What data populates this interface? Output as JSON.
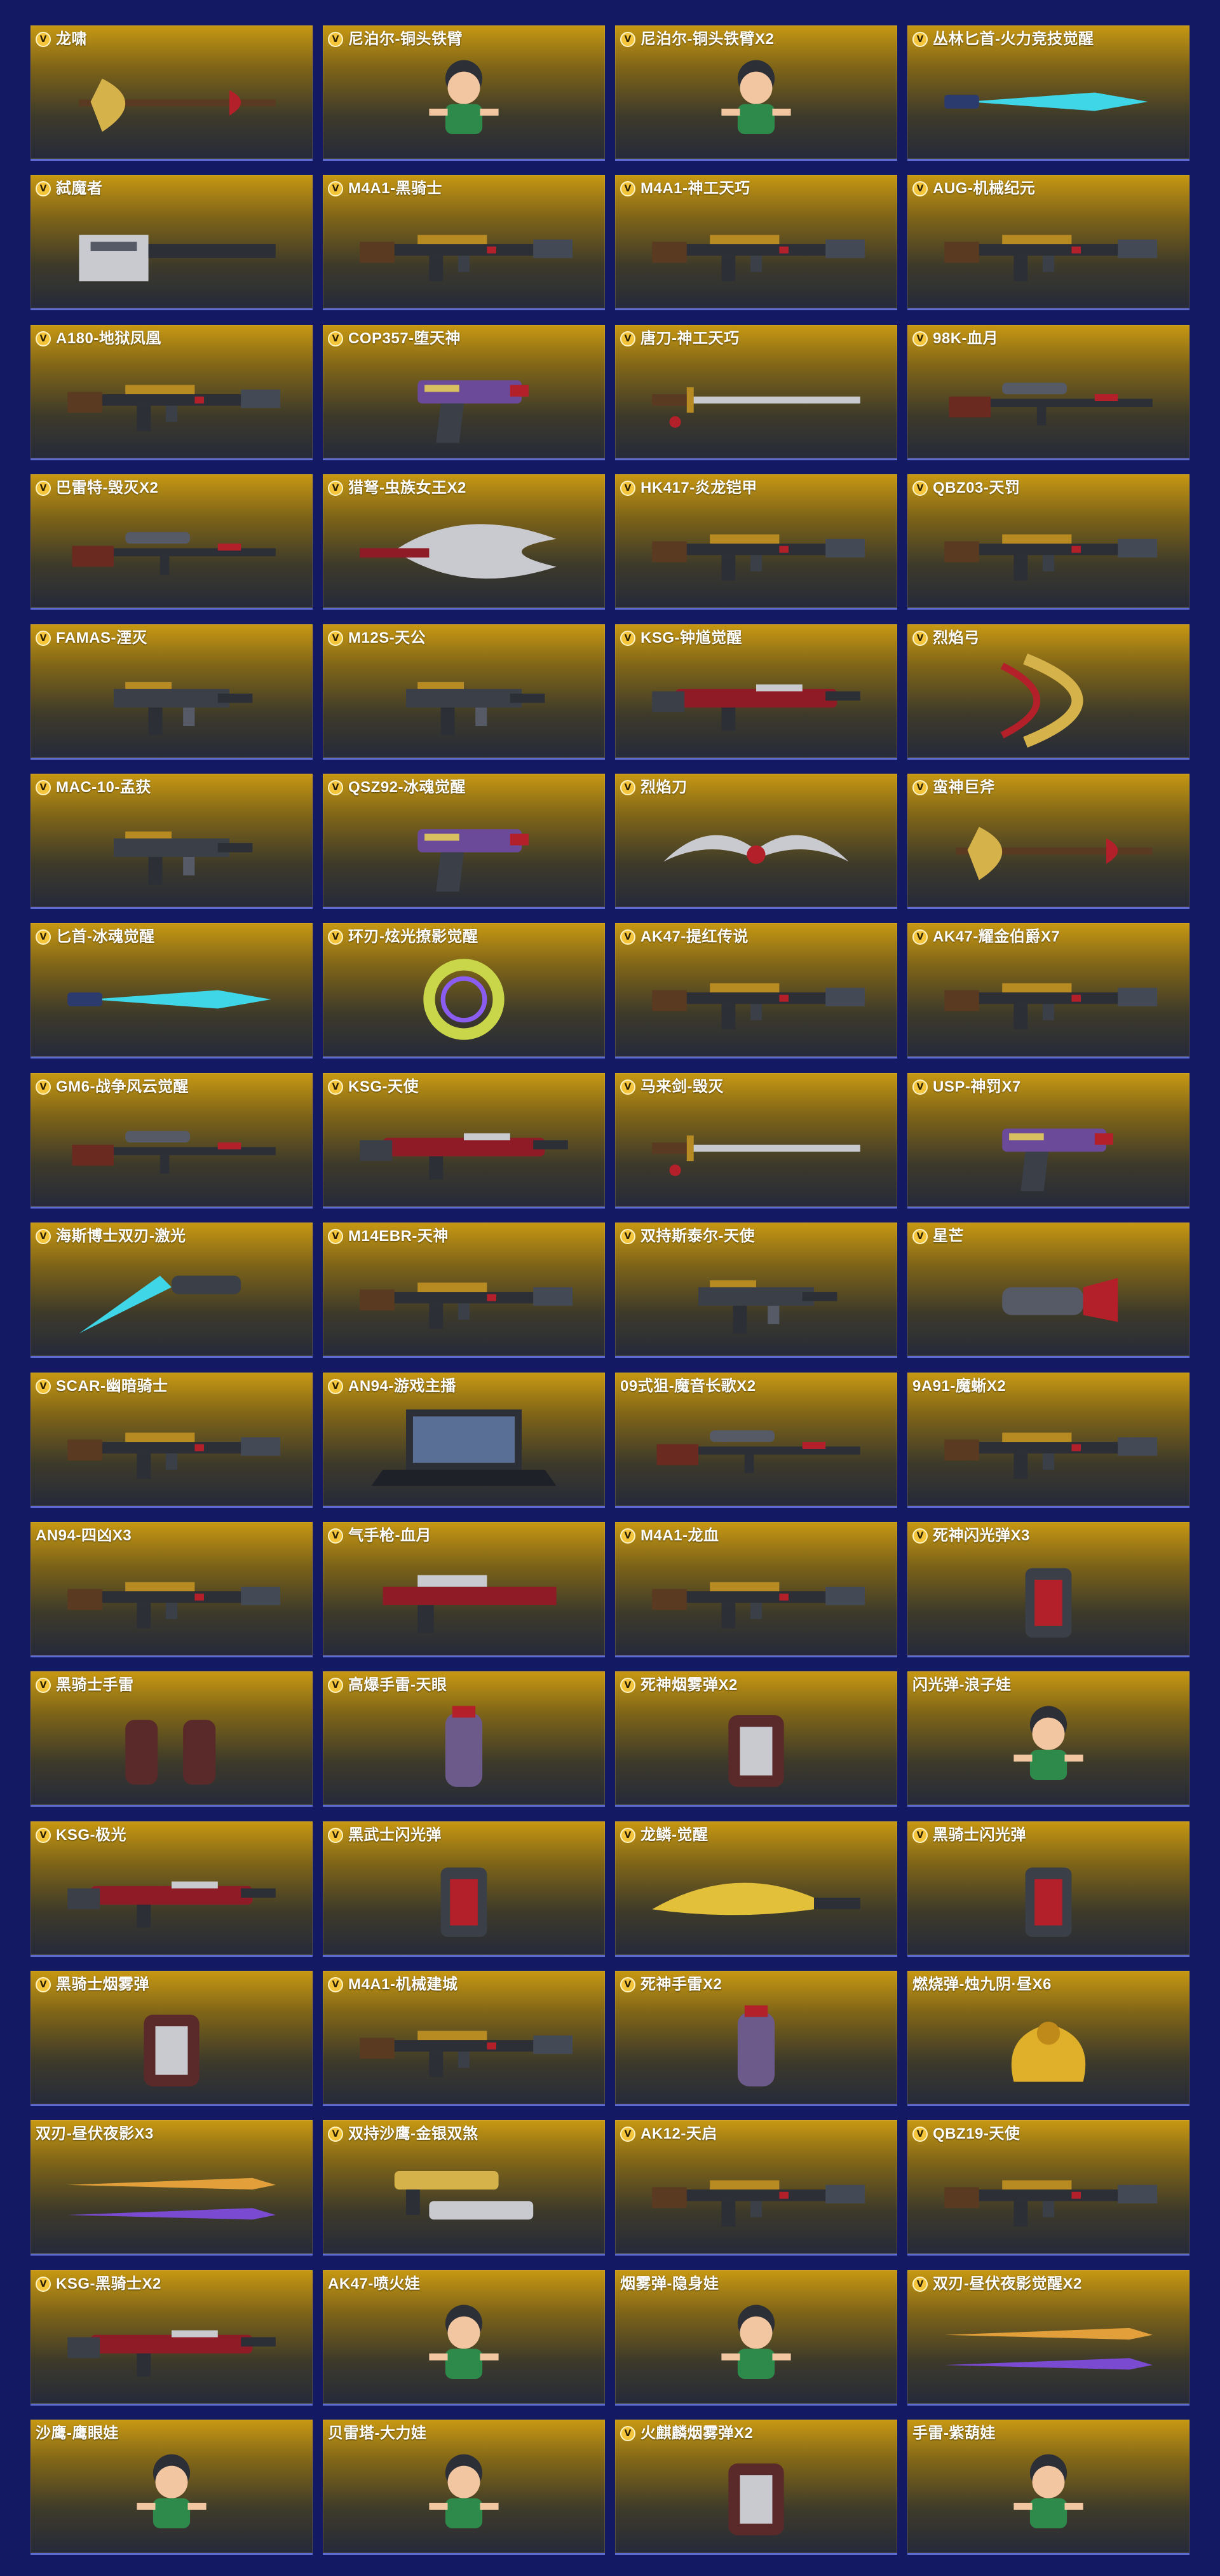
{
  "items": [
    {
      "name": "龙啸",
      "vip": true,
      "badge": "V",
      "icon": "axe-icon"
    },
    {
      "name": "尼泊尔-铜头铁臂",
      "vip": true,
      "badge": "V",
      "icon": "calabash-boy-icon"
    },
    {
      "name": "尼泊尔-铜头铁臂X2",
      "vip": true,
      "badge": "V",
      "icon": "calabash-boy-icon"
    },
    {
      "name": "丛林匕首-火力竞技觉醒",
      "vip": true,
      "badge": "V",
      "icon": "knife-icon"
    },
    {
      "name": "弑魔者",
      "vip": true,
      "badge": "V",
      "icon": "heavy-gun-icon"
    },
    {
      "name": "M4A1-黑骑士",
      "vip": true,
      "badge": "V",
      "icon": "rifle-icon"
    },
    {
      "name": "M4A1-神工天巧",
      "vip": true,
      "badge": "V",
      "icon": "rifle-icon"
    },
    {
      "name": "AUG-机械纪元",
      "vip": true,
      "badge": "V",
      "icon": "rifle-icon"
    },
    {
      "name": "A180-地狱凤凰",
      "vip": true,
      "badge": "V",
      "icon": "rifle-icon"
    },
    {
      "name": "COP357-堕天神",
      "vip": true,
      "badge": "V",
      "icon": "pistol-icon"
    },
    {
      "name": "唐刀-神工天巧",
      "vip": true,
      "badge": "V",
      "icon": "sword-icon"
    },
    {
      "name": "98K-血月",
      "vip": true,
      "badge": "V",
      "icon": "sniper-icon"
    },
    {
      "name": "巴雷特-毁灭X2",
      "vip": true,
      "badge": "V",
      "icon": "sniper-icon"
    },
    {
      "name": "猎弩-虫族女王X2",
      "vip": true,
      "badge": "V",
      "icon": "crossbow-icon"
    },
    {
      "name": "HK417-炎龙铠甲",
      "vip": true,
      "badge": "V",
      "icon": "rifle-icon"
    },
    {
      "name": "QBZ03-天罚",
      "vip": true,
      "badge": "V",
      "icon": "rifle-icon"
    },
    {
      "name": "FAMAS-湮灭",
      "vip": true,
      "badge": "V",
      "icon": "smg-icon"
    },
    {
      "name": "M12S-天公",
      "vip": true,
      "badge": "V",
      "icon": "smg-icon"
    },
    {
      "name": "KSG-钟馗觉醒",
      "vip": true,
      "badge": "V",
      "icon": "shotgun-icon"
    },
    {
      "name": "烈焰弓",
      "vip": true,
      "badge": "V",
      "icon": "bow-icon"
    },
    {
      "name": "MAC-10-孟获",
      "vip": true,
      "badge": "V",
      "icon": "smg-icon"
    },
    {
      "name": "QSZ92-冰魂觉醒",
      "vip": true,
      "badge": "V",
      "icon": "pistol-icon"
    },
    {
      "name": "烈焰刀",
      "vip": true,
      "badge": "V",
      "icon": "blade-icon"
    },
    {
      "name": "蛮神巨斧",
      "vip": true,
      "badge": "V",
      "icon": "axe-icon"
    },
    {
      "name": "匕首-冰魂觉醒",
      "vip": true,
      "badge": "V",
      "icon": "knife-icon"
    },
    {
      "name": "环刃-炫光撩影觉醒",
      "vip": true,
      "badge": "V",
      "icon": "ring-blade-icon"
    },
    {
      "name": "AK47-提红传说",
      "vip": true,
      "badge": "V",
      "icon": "rifle-icon"
    },
    {
      "name": "AK47-耀金伯爵X7",
      "vip": true,
      "badge": "V",
      "icon": "rifle-icon"
    },
    {
      "name": "GM6-战争风云觉醒",
      "vip": true,
      "badge": "V",
      "icon": "sniper-icon"
    },
    {
      "name": "KSG-天使",
      "vip": true,
      "badge": "V",
      "icon": "shotgun-icon"
    },
    {
      "name": "马来剑-毁灭",
      "vip": true,
      "badge": "V",
      "icon": "sword-icon"
    },
    {
      "name": "USP-神罚X7",
      "vip": true,
      "badge": "V",
      "icon": "pistol-icon"
    },
    {
      "name": "海斯博士双刃-激光",
      "vip": true,
      "badge": "V",
      "icon": "laser-blade-icon"
    },
    {
      "name": "M14EBR-天神",
      "vip": true,
      "badge": "V",
      "icon": "rifle-icon"
    },
    {
      "name": "双持斯泰尔-天使",
      "vip": true,
      "badge": "V",
      "icon": "smg-icon"
    },
    {
      "name": "星芒",
      "vip": true,
      "badge": "V",
      "icon": "gauntlet-icon"
    },
    {
      "name": "SCAR-幽暗骑士",
      "vip": true,
      "badge": "V",
      "icon": "rifle-icon"
    },
    {
      "name": "AN94-游戏主播",
      "vip": true,
      "badge": "V",
      "icon": "laptop-icon"
    },
    {
      "name": "09式狙-魔音长歌X2",
      "vip": false,
      "badge": "",
      "icon": "sniper-icon"
    },
    {
      "name": "9A91-魔蜥X2",
      "vip": false,
      "badge": "",
      "icon": "rifle-icon"
    },
    {
      "name": "AN94-四凶X3",
      "vip": false,
      "badge": "",
      "icon": "rifle-icon"
    },
    {
      "name": "气手枪-血月",
      "vip": true,
      "badge": "V",
      "icon": "air-gun-icon"
    },
    {
      "name": "M4A1-龙血",
      "vip": true,
      "badge": "V",
      "icon": "rifle-icon"
    },
    {
      "name": "死神闪光弹X3",
      "vip": true,
      "badge": "V",
      "icon": "flashbang-icon"
    },
    {
      "name": "黑骑士手雷",
      "vip": true,
      "badge": "V",
      "icon": "grenade-pair-icon"
    },
    {
      "name": "高爆手雷-天眼",
      "vip": true,
      "badge": "V",
      "icon": "grenade-icon"
    },
    {
      "name": "死神烟雾弹X2",
      "vip": true,
      "badge": "V",
      "icon": "smoke-grenade-icon"
    },
    {
      "name": "闪光弹-浪子娃",
      "vip": false,
      "badge": "",
      "icon": "calabash-boy-icon"
    },
    {
      "name": "KSG-极光",
      "vip": true,
      "badge": "V",
      "icon": "shotgun-icon"
    },
    {
      "name": "黑武士闪光弹",
      "vip": true,
      "badge": "V",
      "icon": "flashbang-icon"
    },
    {
      "name": "龙鳞-觉醒",
      "vip": true,
      "badge": "V",
      "icon": "machete-icon"
    },
    {
      "name": "黑骑士闪光弹",
      "vip": true,
      "badge": "V",
      "icon": "flashbang-icon"
    },
    {
      "name": "黑骑士烟雾弹",
      "vip": true,
      "badge": "V",
      "icon": "smoke-grenade-icon"
    },
    {
      "name": "M4A1-机械建城",
      "vip": true,
      "badge": "V",
      "icon": "rifle-icon"
    },
    {
      "name": "死神手雷X2",
      "vip": true,
      "badge": "V",
      "icon": "grenade-icon"
    },
    {
      "name": "燃烧弹-烛九阴·昼X6",
      "vip": false,
      "badge": "",
      "icon": "dragon-icon"
    },
    {
      "name": "双刃-昼伏夜影X3",
      "vip": false,
      "badge": "",
      "icon": "dual-blade-icon"
    },
    {
      "name": "双持沙鹰-金银双煞",
      "vip": true,
      "badge": "V",
      "icon": "dual-pistol-icon"
    },
    {
      "name": "AK12-天启",
      "vip": true,
      "badge": "V",
      "icon": "rifle-icon"
    },
    {
      "name": "QBZ19-天使",
      "vip": true,
      "badge": "V",
      "icon": "rifle-icon"
    },
    {
      "name": "KSG-黑骑士X2",
      "vip": true,
      "badge": "V",
      "icon": "shotgun-icon"
    },
    {
      "name": "AK47-喷火娃",
      "vip": false,
      "badge": "",
      "icon": "calabash-boy-icon"
    },
    {
      "name": "烟雾弹-隐身娃",
      "vip": false,
      "badge": "",
      "icon": "calabash-boy-icon"
    },
    {
      "name": "双刃-昼伏夜影觉醒X2",
      "vip": true,
      "badge": "V",
      "icon": "dual-blade-icon"
    },
    {
      "name": "沙鹰-鹰眼娃",
      "vip": false,
      "badge": "",
      "icon": "calabash-boy-icon"
    },
    {
      "name": "贝雷塔-大力娃",
      "vip": false,
      "badge": "",
      "icon": "calabash-boy-icon"
    },
    {
      "name": "火麒麟烟雾弹X2",
      "vip": true,
      "badge": "V",
      "icon": "smoke-grenade-icon"
    },
    {
      "name": "手雷-紫葫娃",
      "vip": false,
      "badge": "",
      "icon": "calabash-boy-icon"
    }
  ],
  "palette": {
    "page_bg": "#131a63",
    "card_gold": "#c79812",
    "card_dark": "#262a3a",
    "badge_gold": "#f4c43a",
    "accent_red": "#b3202a",
    "accent_cyan": "#3fd6e8"
  }
}
